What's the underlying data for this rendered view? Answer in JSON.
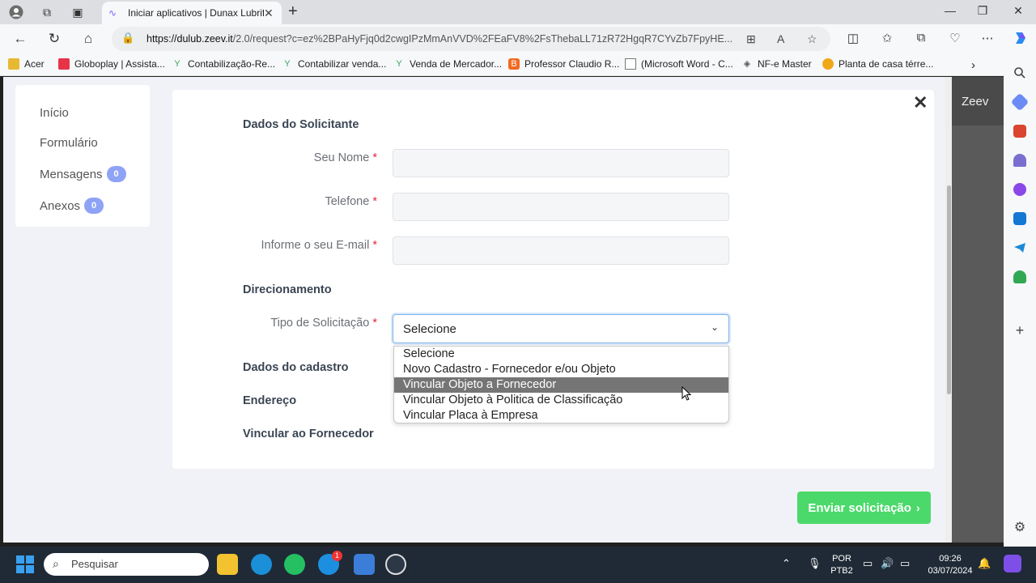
{
  "browser": {
    "tab_title": "Iniciar aplicativos | Dunax Lubrific",
    "url_host": "https://dulub.zeev.it",
    "url_path": "/2.0/request?c=ez%2BPaHyFjq0d2cwgIPzMmAnVVD%2FEaFV8%2FsThebaLL71zR72HgqR7CYvZb7FpyHE...",
    "bookmarks": [
      {
        "label": "Acer",
        "icon": "folder-icon",
        "color": "#e8b832"
      },
      {
        "label": "Globoplay | Assista...",
        "icon": "globoplay-icon",
        "color": "#e8344a"
      },
      {
        "label": "Contabilização-Re...",
        "icon": "fork-icon",
        "color": "#3aa55d"
      },
      {
        "label": "Contabilizar venda...",
        "icon": "fork-icon",
        "color": "#3aa55d"
      },
      {
        "label": "Venda de Mercador...",
        "icon": "fork-icon",
        "color": "#3aa55d"
      },
      {
        "label": "Professor Claudio R...",
        "icon": "blogger-icon",
        "color": "#f26a21"
      },
      {
        "label": "(Microsoft Word - C...",
        "icon": "document-icon",
        "color": "#777777"
      },
      {
        "label": "NF-e Master",
        "icon": "nfe-icon",
        "color": "#555555"
      },
      {
        "label": "Planta de casa térre...",
        "icon": "house-icon",
        "color": "#f0a81b"
      }
    ]
  },
  "page": {
    "brand": "Zeev",
    "menu": {
      "inicio": "Início",
      "formulario": "Formulário",
      "mensagens": "Mensagens",
      "mensagens_count": "0",
      "anexos": "Anexos",
      "anexos_count": "0"
    },
    "close_symbol": "✕",
    "sections": {
      "solicitante": "Dados do Solicitante",
      "direcionamento": "Direcionamento",
      "cadastro": "Dados do cadastro",
      "endereco": "Endereço",
      "fornecedor": "Vincular ao Fornecedor"
    },
    "fields": {
      "nome_label": "Seu Nome",
      "telefone_label": "Telefone",
      "email_label": "Informe o seu E-mail",
      "tipo_label": "Tipo de Solicitação",
      "required_mark": "*",
      "nome_value": "",
      "telefone_value": "",
      "email_value": ""
    },
    "select": {
      "selected": "Selecione",
      "options": [
        "Selecione",
        "Novo Cadastro - Fornecedor e/ou Objeto",
        "Vincular Objeto a Fornecedor",
        "Vincular Objeto à Politica de Classificação",
        "Vincular Placa à Empresa"
      ],
      "highlighted_index": 2
    },
    "submit": "Enviar solicitação",
    "submit_arrow": "›"
  },
  "taskbar": {
    "search_placeholder": "Pesquisar",
    "language": "POR",
    "layout": "PTB2",
    "time": "09:26",
    "date": "03/07/2024",
    "skype_badge": "1"
  },
  "colors": {
    "accent_green": "#4cd96b",
    "badge_blue": "#8ea3f5",
    "required_red": "#e0283a",
    "highlight_gray": "#757575"
  }
}
